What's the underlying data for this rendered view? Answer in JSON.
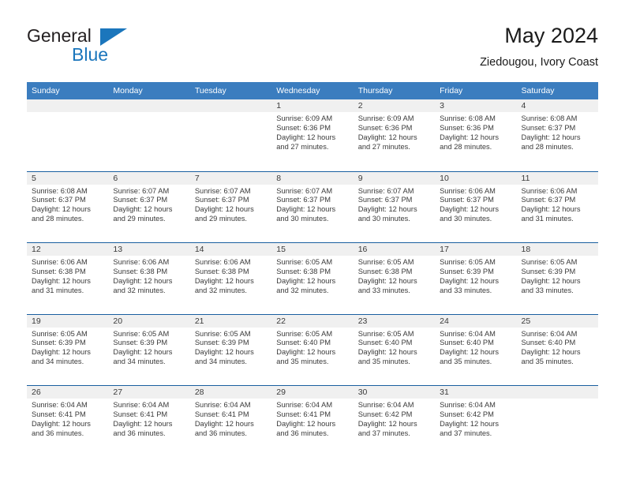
{
  "brand": {
    "name_part1": "General",
    "name_part2": "Blue",
    "accent_color": "#1b76bc"
  },
  "header": {
    "title": "May 2024",
    "subtitle": "Ziedougou, Ivory Coast",
    "header_bg_color": "#3b7dbf",
    "row_divider_color": "#1a5fa0",
    "daynum_bg_color": "#f0f0f0"
  },
  "weekdays": [
    "Sunday",
    "Monday",
    "Tuesday",
    "Wednesday",
    "Thursday",
    "Friday",
    "Saturday"
  ],
  "labels": {
    "sunrise_prefix": "Sunrise:",
    "sunset_prefix": "Sunset:",
    "daylight_prefix": "Daylight:"
  },
  "weeks": [
    [
      {
        "day": "",
        "empty": true,
        "line1": "",
        "line2": "",
        "line3": "",
        "line4": ""
      },
      {
        "day": "",
        "empty": true,
        "line1": "",
        "line2": "",
        "line3": "",
        "line4": ""
      },
      {
        "day": "",
        "empty": true,
        "line1": "",
        "line2": "",
        "line3": "",
        "line4": ""
      },
      {
        "day": "1",
        "empty": false,
        "line1": "Sunrise: 6:09 AM",
        "line2": "Sunset: 6:36 PM",
        "line3": "Daylight: 12 hours",
        "line4": "and 27 minutes."
      },
      {
        "day": "2",
        "empty": false,
        "line1": "Sunrise: 6:09 AM",
        "line2": "Sunset: 6:36 PM",
        "line3": "Daylight: 12 hours",
        "line4": "and 27 minutes."
      },
      {
        "day": "3",
        "empty": false,
        "line1": "Sunrise: 6:08 AM",
        "line2": "Sunset: 6:36 PM",
        "line3": "Daylight: 12 hours",
        "line4": "and 28 minutes."
      },
      {
        "day": "4",
        "empty": false,
        "line1": "Sunrise: 6:08 AM",
        "line2": "Sunset: 6:37 PM",
        "line3": "Daylight: 12 hours",
        "line4": "and 28 minutes."
      }
    ],
    [
      {
        "day": "5",
        "empty": false,
        "line1": "Sunrise: 6:08 AM",
        "line2": "Sunset: 6:37 PM",
        "line3": "Daylight: 12 hours",
        "line4": "and 28 minutes."
      },
      {
        "day": "6",
        "empty": false,
        "line1": "Sunrise: 6:07 AM",
        "line2": "Sunset: 6:37 PM",
        "line3": "Daylight: 12 hours",
        "line4": "and 29 minutes."
      },
      {
        "day": "7",
        "empty": false,
        "line1": "Sunrise: 6:07 AM",
        "line2": "Sunset: 6:37 PM",
        "line3": "Daylight: 12 hours",
        "line4": "and 29 minutes."
      },
      {
        "day": "8",
        "empty": false,
        "line1": "Sunrise: 6:07 AM",
        "line2": "Sunset: 6:37 PM",
        "line3": "Daylight: 12 hours",
        "line4": "and 30 minutes."
      },
      {
        "day": "9",
        "empty": false,
        "line1": "Sunrise: 6:07 AM",
        "line2": "Sunset: 6:37 PM",
        "line3": "Daylight: 12 hours",
        "line4": "and 30 minutes."
      },
      {
        "day": "10",
        "empty": false,
        "line1": "Sunrise: 6:06 AM",
        "line2": "Sunset: 6:37 PM",
        "line3": "Daylight: 12 hours",
        "line4": "and 30 minutes."
      },
      {
        "day": "11",
        "empty": false,
        "line1": "Sunrise: 6:06 AM",
        "line2": "Sunset: 6:37 PM",
        "line3": "Daylight: 12 hours",
        "line4": "and 31 minutes."
      }
    ],
    [
      {
        "day": "12",
        "empty": false,
        "line1": "Sunrise: 6:06 AM",
        "line2": "Sunset: 6:38 PM",
        "line3": "Daylight: 12 hours",
        "line4": "and 31 minutes."
      },
      {
        "day": "13",
        "empty": false,
        "line1": "Sunrise: 6:06 AM",
        "line2": "Sunset: 6:38 PM",
        "line3": "Daylight: 12 hours",
        "line4": "and 32 minutes."
      },
      {
        "day": "14",
        "empty": false,
        "line1": "Sunrise: 6:06 AM",
        "line2": "Sunset: 6:38 PM",
        "line3": "Daylight: 12 hours",
        "line4": "and 32 minutes."
      },
      {
        "day": "15",
        "empty": false,
        "line1": "Sunrise: 6:05 AM",
        "line2": "Sunset: 6:38 PM",
        "line3": "Daylight: 12 hours",
        "line4": "and 32 minutes."
      },
      {
        "day": "16",
        "empty": false,
        "line1": "Sunrise: 6:05 AM",
        "line2": "Sunset: 6:38 PM",
        "line3": "Daylight: 12 hours",
        "line4": "and 33 minutes."
      },
      {
        "day": "17",
        "empty": false,
        "line1": "Sunrise: 6:05 AM",
        "line2": "Sunset: 6:39 PM",
        "line3": "Daylight: 12 hours",
        "line4": "and 33 minutes."
      },
      {
        "day": "18",
        "empty": false,
        "line1": "Sunrise: 6:05 AM",
        "line2": "Sunset: 6:39 PM",
        "line3": "Daylight: 12 hours",
        "line4": "and 33 minutes."
      }
    ],
    [
      {
        "day": "19",
        "empty": false,
        "line1": "Sunrise: 6:05 AM",
        "line2": "Sunset: 6:39 PM",
        "line3": "Daylight: 12 hours",
        "line4": "and 34 minutes."
      },
      {
        "day": "20",
        "empty": false,
        "line1": "Sunrise: 6:05 AM",
        "line2": "Sunset: 6:39 PM",
        "line3": "Daylight: 12 hours",
        "line4": "and 34 minutes."
      },
      {
        "day": "21",
        "empty": false,
        "line1": "Sunrise: 6:05 AM",
        "line2": "Sunset: 6:39 PM",
        "line3": "Daylight: 12 hours",
        "line4": "and 34 minutes."
      },
      {
        "day": "22",
        "empty": false,
        "line1": "Sunrise: 6:05 AM",
        "line2": "Sunset: 6:40 PM",
        "line3": "Daylight: 12 hours",
        "line4": "and 35 minutes."
      },
      {
        "day": "23",
        "empty": false,
        "line1": "Sunrise: 6:05 AM",
        "line2": "Sunset: 6:40 PM",
        "line3": "Daylight: 12 hours",
        "line4": "and 35 minutes."
      },
      {
        "day": "24",
        "empty": false,
        "line1": "Sunrise: 6:04 AM",
        "line2": "Sunset: 6:40 PM",
        "line3": "Daylight: 12 hours",
        "line4": "and 35 minutes."
      },
      {
        "day": "25",
        "empty": false,
        "line1": "Sunrise: 6:04 AM",
        "line2": "Sunset: 6:40 PM",
        "line3": "Daylight: 12 hours",
        "line4": "and 35 minutes."
      }
    ],
    [
      {
        "day": "26",
        "empty": false,
        "line1": "Sunrise: 6:04 AM",
        "line2": "Sunset: 6:41 PM",
        "line3": "Daylight: 12 hours",
        "line4": "and 36 minutes."
      },
      {
        "day": "27",
        "empty": false,
        "line1": "Sunrise: 6:04 AM",
        "line2": "Sunset: 6:41 PM",
        "line3": "Daylight: 12 hours",
        "line4": "and 36 minutes."
      },
      {
        "day": "28",
        "empty": false,
        "line1": "Sunrise: 6:04 AM",
        "line2": "Sunset: 6:41 PM",
        "line3": "Daylight: 12 hours",
        "line4": "and 36 minutes."
      },
      {
        "day": "29",
        "empty": false,
        "line1": "Sunrise: 6:04 AM",
        "line2": "Sunset: 6:41 PM",
        "line3": "Daylight: 12 hours",
        "line4": "and 36 minutes."
      },
      {
        "day": "30",
        "empty": false,
        "line1": "Sunrise: 6:04 AM",
        "line2": "Sunset: 6:42 PM",
        "line3": "Daylight: 12 hours",
        "line4": "and 37 minutes."
      },
      {
        "day": "31",
        "empty": false,
        "line1": "Sunrise: 6:04 AM",
        "line2": "Sunset: 6:42 PM",
        "line3": "Daylight: 12 hours",
        "line4": "and 37 minutes."
      },
      {
        "day": "",
        "empty": true,
        "line1": "",
        "line2": "",
        "line3": "",
        "line4": ""
      }
    ]
  ]
}
